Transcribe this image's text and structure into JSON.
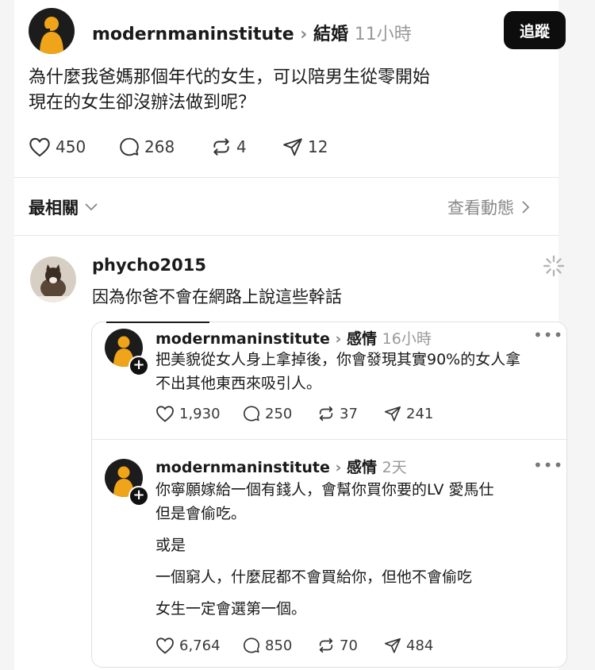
{
  "post": {
    "username": "modernmaninstitute",
    "chevron": "›",
    "topic": "結婚",
    "time": "11小時",
    "follow_label": "追蹤",
    "text_lines": [
      "為什麼我爸媽那個年代的女生，可以陪男生從零開始",
      "現在的女生卻沒辦法做到呢？"
    ],
    "likes": "450",
    "comments": "268",
    "reposts": "4",
    "shares": "12"
  },
  "sort": {
    "label": "最相關",
    "activity_link": "查看動態"
  },
  "reply": {
    "username": "phycho2015",
    "text": "因為你爸不會在網路上說這些幹話"
  },
  "quotes": [
    {
      "username": "modernmaninstitute",
      "chevron": "›",
      "topic": "感情",
      "time": "16小時",
      "more": "•••",
      "text_lines": [
        "把美貌從女人身上拿掉後，你會發現其實90%的女人拿",
        "不出其他東西來吸引人。"
      ],
      "likes": "1,930",
      "comments": "250",
      "reposts": "37",
      "shares": "241"
    },
    {
      "username": "modernmaninstitute",
      "chevron": "›",
      "topic": "感情",
      "time": "2天",
      "more": "•••",
      "text_lines": [
        "你寧願嫁給一個有錢人，會幫你買你要的LV 愛馬仕",
        "但是會偷吃。",
        "或是",
        "一個窮人，什麼屁都不會買給你，但他不會偷吃",
        "女生一定會選第一個。"
      ],
      "likes": "6,764",
      "comments": "850",
      "reposts": "70",
      "shares": "484"
    }
  ],
  "icons": [
    "heart-icon",
    "comment-icon",
    "repost-icon",
    "share-icon",
    "chevron-down-icon",
    "chevron-right-icon",
    "loading-spinner-icon",
    "plus-icon"
  ],
  "colors": {
    "follow_bg": "#0d0d0d",
    "muted": "#888888",
    "divider": "#e6e6e6"
  }
}
